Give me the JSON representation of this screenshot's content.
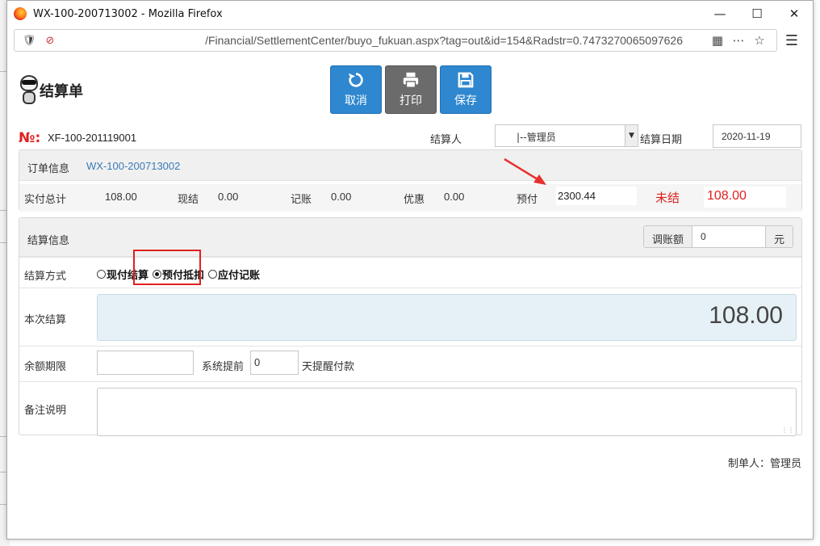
{
  "window": {
    "title": "WX-100-200713002 - Mozilla Firefox",
    "url": "/Financial/SettlementCenter/buyo_fukuan.aspx?tag=out&id=154&Radstr=0.7473270065097626"
  },
  "header": {
    "title": "结算单",
    "buttons": {
      "cancel": "取消",
      "print": "打印",
      "save": "保存"
    }
  },
  "doc": {
    "no_label": "№:",
    "no_value": "XF-100-201119001",
    "settler_label": "结算人",
    "settler_value": "|--管理员",
    "date_label": "结算日期",
    "date_value": "2020-11-19"
  },
  "order": {
    "title": "订单信息",
    "order_no": "WX-100-200713002",
    "actual_total_label": "实付总计",
    "actual_total": "108.00",
    "cash_label": "现结",
    "cash": "0.00",
    "credit_label": "记账",
    "credit": "0.00",
    "discount_label": "优惠",
    "discount": "0.00",
    "prepay_label": "预付",
    "prepay": "2300.44",
    "unsettled_label": "未结",
    "unsettled": "108.00"
  },
  "settlement": {
    "title": "结算信息",
    "adjust_label": "调账额",
    "adjust_value": "0",
    "adjust_unit": "元",
    "method_label": "结算方式",
    "methods": [
      "现付结算",
      "预付抵扣",
      "应付记账"
    ],
    "selected_method": "预付抵扣",
    "current_label": "本次结算",
    "current_amount": "108.00",
    "deadline_label": "余额期限",
    "deadline_value": "",
    "remind_prefix": "系统提前",
    "remind_days": "0",
    "remind_suffix": "天提醒付款",
    "remark_label": "备注说明",
    "remark_value": ""
  },
  "footer": {
    "maker": "制单人：管理员"
  },
  "colors": {
    "primary": "#2e87cf",
    "gray_button": "#6b6b6b",
    "alert": "#e02020"
  }
}
